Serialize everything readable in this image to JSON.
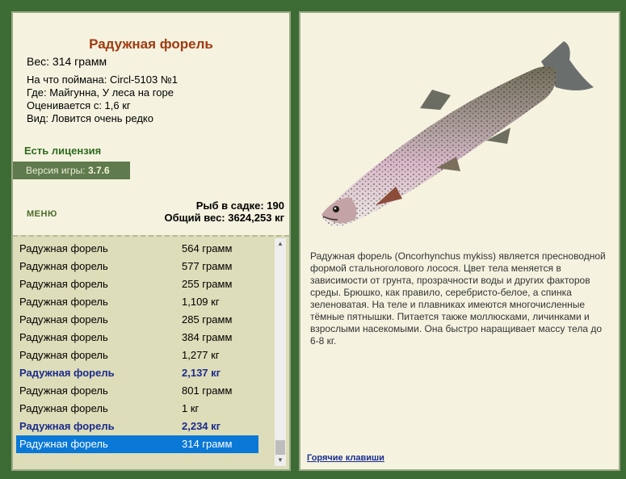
{
  "fish": {
    "title": "Радужная форель",
    "weight": "Вес: 314 грамм",
    "caught_on": "На что поймана: Circl-5103 №1",
    "where": "Где: Майгунна, У леса на горе",
    "value": "Оценивается с: 1,6 кг",
    "kind": "Вид: Ловится очень редко",
    "license": "Есть лицензия",
    "version_label": "Версия игры:",
    "version": "3.7.6"
  },
  "menu": {
    "label": "МЕНЮ"
  },
  "stats": {
    "count": "Рыб в садке: 190",
    "total": "Общий вес: 3624,253 кг"
  },
  "catch_list": [
    {
      "name": "Радужная форель",
      "weight": "564 грамм",
      "bold": false,
      "selected": false
    },
    {
      "name": "Радужная форель",
      "weight": "577 грамм",
      "bold": false,
      "selected": false
    },
    {
      "name": "Радужная форель",
      "weight": "255 грамм",
      "bold": false,
      "selected": false
    },
    {
      "name": "Радужная форель",
      "weight": "1,109 кг",
      "bold": false,
      "selected": false
    },
    {
      "name": "Радужная форель",
      "weight": "285 грамм",
      "bold": false,
      "selected": false
    },
    {
      "name": "Радужная форель",
      "weight": "384 грамм",
      "bold": false,
      "selected": false
    },
    {
      "name": "Радужная форель",
      "weight": "1,277 кг",
      "bold": false,
      "selected": false
    },
    {
      "name": "Радужная форель",
      "weight": "2,137 кг",
      "bold": true,
      "selected": false
    },
    {
      "name": "Радужная форель",
      "weight": "801 грамм",
      "bold": false,
      "selected": false
    },
    {
      "name": "Радужная форель",
      "weight": "1 кг",
      "bold": false,
      "selected": false
    },
    {
      "name": "Радужная форель",
      "weight": "2,234 кг",
      "bold": true,
      "selected": false
    },
    {
      "name": "Радужная форель",
      "weight": "314 грамм",
      "bold": false,
      "selected": true
    }
  ],
  "description": "Радужная форель (Oncorhynchus mykiss) является пресноводной формой стальноголового лосося. Цвет тела меняется в зависимости от грунта, прозрачности воды и других факторов среды. Брюшко, как правило, серебристо-белое, а спинка зеленоватая. На теле и плавниках имеются многочисленные тёмные пятнышки. Питается также моллюсками, личинками и взрослыми насекомыми. Она быстро наращивает массу тела до 6-8 кг.",
  "hotkeys": "Горячие клавиши",
  "colors": {
    "background": "#3d6b34",
    "panel": "#f5f3e0",
    "title": "#a03a10",
    "license": "#2e6a1f",
    "selected_row": "#0a78d7",
    "bold_row": "#1c2b8c"
  }
}
